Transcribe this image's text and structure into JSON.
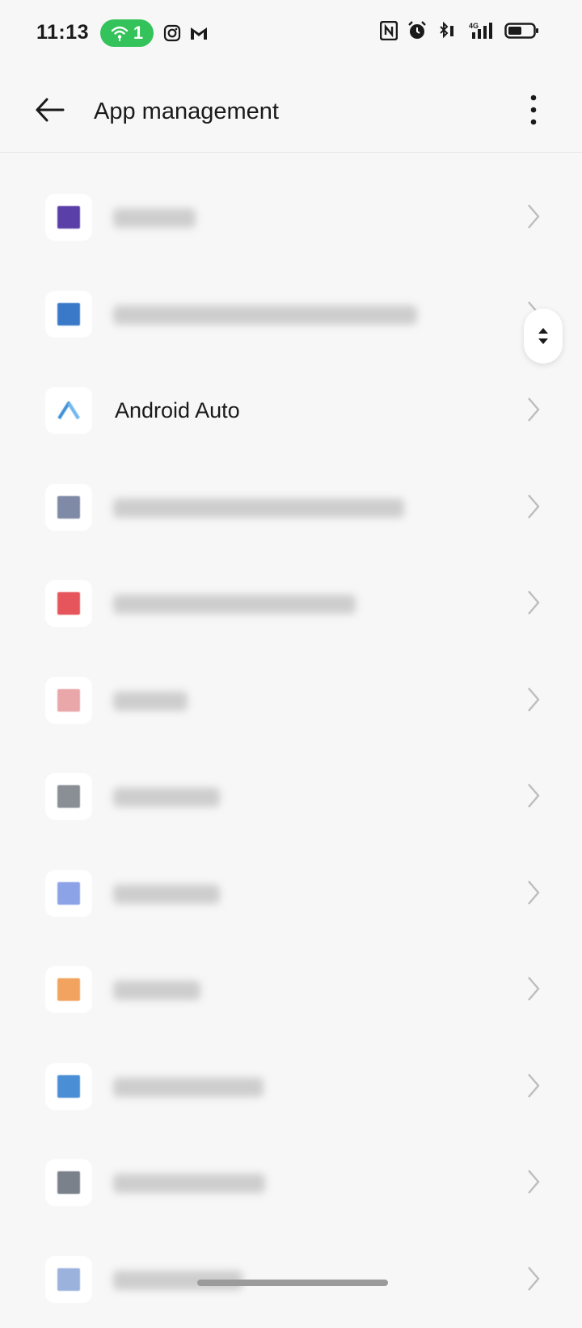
{
  "status_bar": {
    "time": "11:13",
    "hotspot_count": "1",
    "icons": [
      "instagram-icon",
      "gmail-icon",
      "nfc-icon",
      "alarm-icon",
      "bluetooth-icon",
      "signal-4g-icon",
      "battery-icon"
    ]
  },
  "app_bar": {
    "title": "App management",
    "back_icon": "back-arrow-icon",
    "more_icon": "more-vertical-icon"
  },
  "apps": [
    {
      "name": "",
      "icon_color": "#5a3fa8"
    },
    {
      "name": "",
      "icon_color": "#3a78c8"
    },
    {
      "name": "Android Auto",
      "icon_color": "#3c8fd6"
    },
    {
      "name": "",
      "icon_color": "#7f8aa6"
    },
    {
      "name": "",
      "icon_color": "#e5555b"
    },
    {
      "name": "",
      "icon_color": "#e9a7aa"
    },
    {
      "name": "",
      "icon_color": "#8a8f96"
    },
    {
      "name": "",
      "icon_color": "#8da3e8"
    },
    {
      "name": "",
      "icon_color": "#f1a35f"
    },
    {
      "name": "",
      "icon_color": "#4a8fd6"
    },
    {
      "name": "",
      "icon_color": "#7b818a"
    },
    {
      "name": "",
      "icon_color": "#9bb2dc"
    }
  ],
  "colors": {
    "accent_green": "#33c35a",
    "background": "#f7f7f7"
  }
}
